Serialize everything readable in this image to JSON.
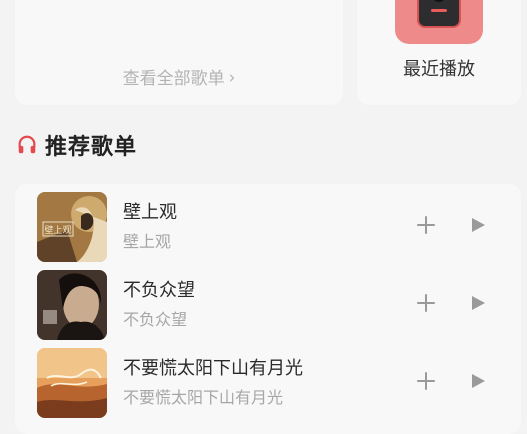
{
  "top_left_card": {
    "view_all_label": "查看全部歌单",
    "chevron": "chevron-right-icon"
  },
  "top_right_card": {
    "label": "最近播放",
    "icon": "recent-play-device-icon"
  },
  "section": {
    "title": "推荐歌单",
    "icon": "headphones-icon",
    "icon_color": "#e5484d"
  },
  "songs": [
    {
      "title": "壁上观",
      "subtitle": "壁上观",
      "cover_text": "壁上观"
    },
    {
      "title": "不负众望",
      "subtitle": "不负众望"
    },
    {
      "title": "不要慌太阳下山有月光",
      "subtitle": "不要慌太阳下山有月光"
    }
  ],
  "colors": {
    "accent": "#e5484d",
    "text_primary": "#2a2a2a",
    "text_secondary": "#a6a6a6"
  }
}
